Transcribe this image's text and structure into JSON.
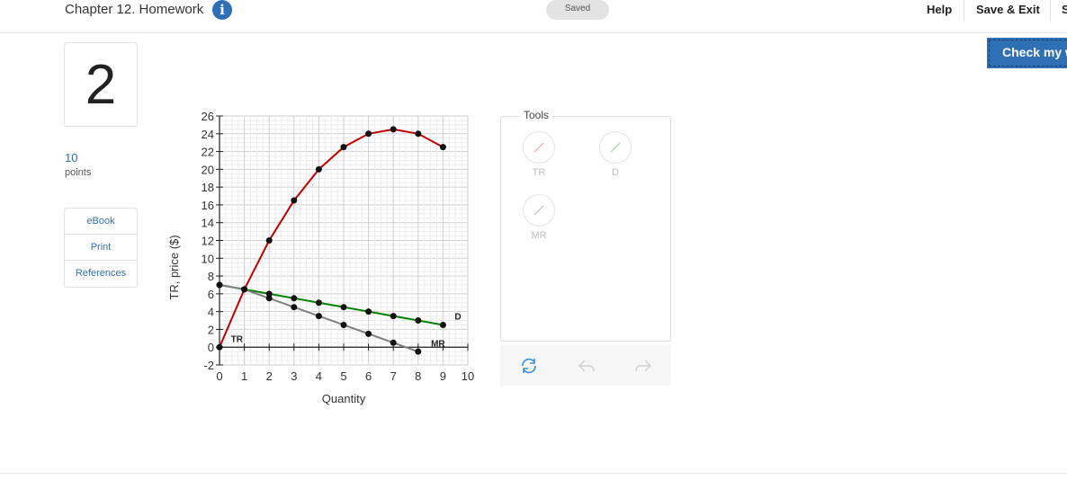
{
  "header": {
    "title": "Chapter 12. Homework",
    "saved_label": "Saved",
    "help_label": "Help",
    "save_exit_label": "Save & Exit",
    "submit_partial": "S"
  },
  "check_button_label": "Check my w",
  "question": {
    "number": "2",
    "points_value": "10",
    "points_label": "points"
  },
  "side_links": [
    "eBook",
    "Print",
    "References"
  ],
  "tools": {
    "title": "Tools",
    "items": [
      {
        "label": "TR",
        "color": "#f5a3a3"
      },
      {
        "label": "D",
        "color": "#9fd09f"
      },
      {
        "label": "MR",
        "color": "#bdbdbd"
      }
    ]
  },
  "chart_data": {
    "type": "line",
    "xlabel": "Quantity",
    "ylabel": "TR, price ($)",
    "xlim": [
      0,
      10
    ],
    "ylim": [
      -2,
      26
    ],
    "x_ticks": [
      0,
      1,
      2,
      3,
      4,
      5,
      6,
      7,
      8,
      9,
      10
    ],
    "y_ticks": [
      -2,
      0,
      2,
      4,
      6,
      8,
      10,
      12,
      14,
      16,
      18,
      20,
      22,
      24,
      26
    ],
    "grid": true,
    "series": [
      {
        "name": "TR",
        "color": "#c00000",
        "x": [
          0,
          1,
          2,
          3,
          4,
          5,
          6,
          7,
          8,
          9
        ],
        "y": [
          0,
          6.5,
          12,
          16.5,
          20,
          22.5,
          24,
          24.5,
          24,
          22.5
        ],
        "label_at": [
          0.7,
          1
        ]
      },
      {
        "name": "D",
        "color": "#008000",
        "x": [
          0,
          1,
          2,
          3,
          4,
          5,
          6,
          7,
          8,
          9
        ],
        "y": [
          7,
          6.5,
          6,
          5.5,
          5,
          4.5,
          4,
          3.5,
          3,
          2.5
        ],
        "label_at": [
          9.6,
          3.5
        ]
      },
      {
        "name": "MR",
        "color": "#808080",
        "x": [
          0,
          1,
          2,
          3,
          4,
          5,
          6,
          7,
          8
        ],
        "y": [
          7,
          6.5,
          5.5,
          4.5,
          3.5,
          2.5,
          1.5,
          0.5,
          -0.5
        ],
        "label_at": [
          8.8,
          0.5
        ]
      }
    ]
  }
}
